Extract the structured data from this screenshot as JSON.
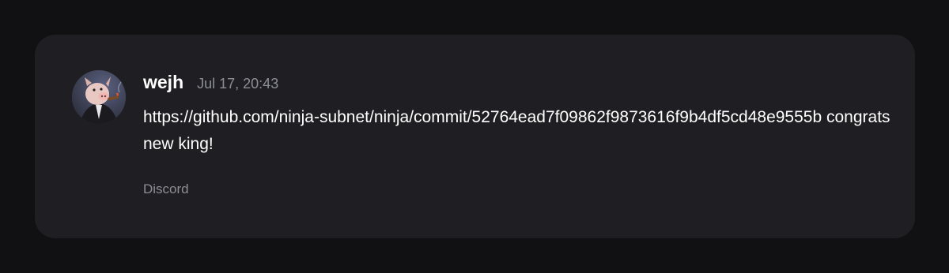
{
  "post": {
    "username": "wejh",
    "timestamp": "Jul 17, 20:43",
    "message": "https://github.com/ninja-subnet/ninja/commit/52764ead7f09862f9873616f9b4df5cd48e9555b congrats new king!",
    "source": "Discord",
    "avatar_icon": "pig-with-cigar-avatar"
  },
  "colors": {
    "page_background": "#111113",
    "card_background": "#1f1f23",
    "primary_text": "#ffffff",
    "secondary_text": "#8d8e94"
  }
}
